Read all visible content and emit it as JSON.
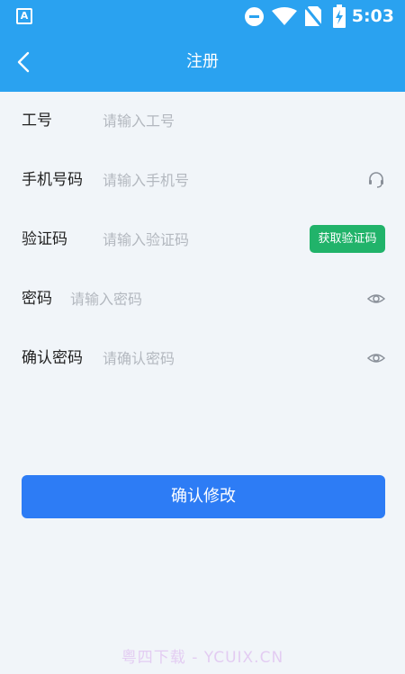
{
  "status_bar": {
    "app_badge": "A",
    "time": "5:03",
    "icons": [
      "app-badge-icon",
      "do-not-disturb-icon",
      "wifi-icon",
      "no-sim-icon",
      "battery-charging-icon"
    ]
  },
  "header": {
    "back_icon": "chevron-left-icon",
    "title": "注册"
  },
  "form": {
    "employee_id": {
      "label": "工号",
      "placeholder": "请输入工号"
    },
    "phone": {
      "label": "手机号码",
      "placeholder": "请输入手机号",
      "trailing_icon": "headset-icon"
    },
    "verification": {
      "label": "验证码",
      "placeholder": "请输入验证码",
      "button": "获取验证码"
    },
    "password": {
      "label": "密码",
      "placeholder": "请输入密码",
      "trailing_icon": "eye-icon"
    },
    "confirm_password": {
      "label": "确认密码",
      "placeholder": "请确认密码",
      "trailing_icon": "eye-icon"
    }
  },
  "submit_button": "确认修改",
  "watermark": "粤四下载 - YCUIX.CN",
  "colors": {
    "header_bg": "#2aa2f0",
    "submit_bg": "#2d7cf5",
    "get_code_bg": "#21b36a",
    "page_bg": "#f1f5f9"
  }
}
